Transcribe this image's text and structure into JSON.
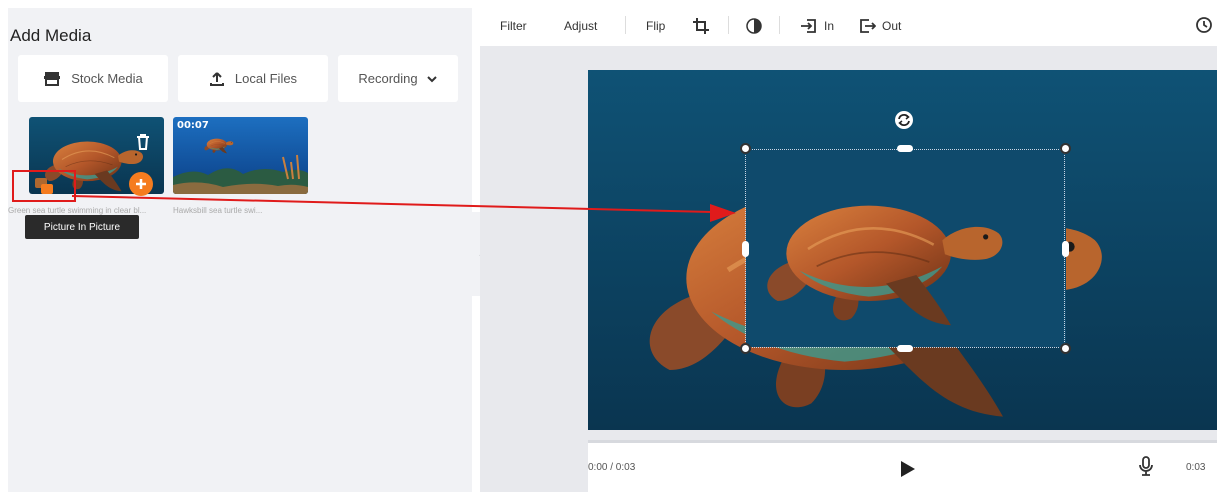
{
  "left_panel": {
    "title": "Add Media",
    "buttons": {
      "stock_media": "Stock Media",
      "local_files": "Local Files",
      "recording": "Recording"
    },
    "thumbnails": [
      {
        "caption": "Green sea turtle swimming in clear bl...",
        "duration": "",
        "icons": [
          "trash-icon",
          "plus-icon",
          "picture-in-picture-icon"
        ]
      },
      {
        "caption": "Hawksbill sea turtle swi...",
        "duration": "00:07"
      }
    ],
    "tooltip": "Picture In Picture"
  },
  "toolbar": {
    "filter": "Filter",
    "adjust": "Adjust",
    "flip": "Flip",
    "in_label": "In",
    "out_label": "Out",
    "icons": [
      "crop-icon",
      "color-icon",
      "fade-in-icon",
      "fade-out-icon",
      "history-icon"
    ]
  },
  "player": {
    "time": "0:00 / 0:03",
    "end_time": "0:03",
    "progress": 0,
    "icons": [
      "play-icon",
      "microphone-icon",
      "rotate-icon"
    ]
  },
  "colors": {
    "accent_orange": "#f57c1f",
    "annotation_red": "#e01b1b",
    "ocean_blue": "#0e4a6e",
    "panel_bg": "#f1f2f5"
  }
}
